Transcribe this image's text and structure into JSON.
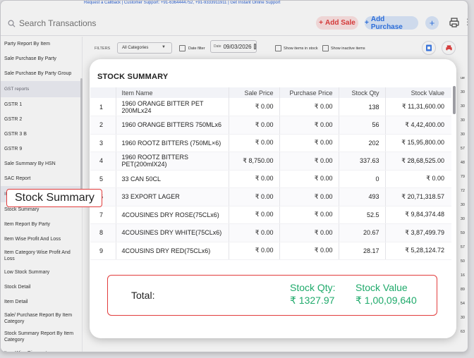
{
  "top_strip": "Request a Callback | Customer Support: +91-6364444752, +91-9333911911 | Get Instant Online Support",
  "header": {
    "search_placeholder": "Search Transactions",
    "add_sale": "Add Sale",
    "add_purchase": "Add Purchase",
    "plus": "+",
    "more": "⋮"
  },
  "sidebar": {
    "items": [
      {
        "label": "Party Report By Item",
        "type": "item"
      },
      {
        "label": "Sale Purchase By Party",
        "type": "item"
      },
      {
        "label": "Sale Purchase By Party Group",
        "type": "item"
      },
      {
        "label": "GST reports",
        "type": "section"
      },
      {
        "label": "GSTR 1",
        "type": "item"
      },
      {
        "label": "GSTR 2",
        "type": "item"
      },
      {
        "label": "GSTR 3 B",
        "type": "item"
      },
      {
        "label": "GSTR 9",
        "type": "item"
      },
      {
        "label": "Sale Summary By HSN",
        "type": "item"
      },
      {
        "label": "SAC Report",
        "type": "item"
      },
      {
        "label": "Item/ Stock report",
        "type": "section"
      },
      {
        "label": "Stock Summary",
        "type": "item"
      },
      {
        "label": "Item Report By Party",
        "type": "item"
      },
      {
        "label": "Item Wise Profit And Loss",
        "type": "item"
      },
      {
        "label": "Item Category Wise Profit And Loss",
        "type": "tall"
      },
      {
        "label": "Low Stock Summary",
        "type": "item"
      },
      {
        "label": "Stock Detail",
        "type": "item"
      },
      {
        "label": "Item Detail",
        "type": "item"
      },
      {
        "label": "Sale/ Purchase Report By Item Category",
        "type": "tall"
      },
      {
        "label": "Stock Summary Report By Item Category",
        "type": "tall"
      },
      {
        "label": "Item Wise Discount",
        "type": "item"
      }
    ],
    "highlight_label": "Stock Summary"
  },
  "filters": {
    "label": "FILTERS",
    "category": "All Categories",
    "date_filter_label": "Date filter",
    "date_caption": "Date",
    "date_value": "09/03/2026",
    "items_in_stock_label": "Show items in stock",
    "inactive_label": "Show inactive items"
  },
  "bg_right_col": [
    "ue",
    "30",
    "30",
    "30",
    "30",
    "57",
    "48",
    "79",
    "72",
    "30",
    "30",
    "59",
    "57",
    "50",
    "16",
    "89",
    "54",
    "30",
    "63"
  ],
  "modal": {
    "title": "STOCK SUMMARY",
    "columns": [
      "",
      "Item Name",
      "Sale Price",
      "Purchase Price",
      "Stock Qty",
      "Stock Value"
    ],
    "rows": [
      {
        "idx": "1",
        "name": "1960 ORANGE BITTER PET 200MLx24",
        "sale": "₹ 0.00",
        "purchase": "₹ 0.00",
        "qty": "138",
        "value": "₹ 11,31,600.00"
      },
      {
        "idx": "2",
        "name": "1960 ORANGE BITTERS 750MLx6",
        "sale": "₹ 0.00",
        "purchase": "₹ 0.00",
        "qty": "56",
        "value": "₹ 4,42,400.00"
      },
      {
        "idx": "3",
        "name": "1960 ROOTZ BITTERS (750ML×6)",
        "sale": "₹ 0.00",
        "purchase": "₹ 0.00",
        "qty": "202",
        "value": "₹ 15,95,800.00"
      },
      {
        "idx": "4",
        "name": "1960 ROOTZ BITTERS PET(200mlX24)",
        "sale": "₹ 8,750.00",
        "purchase": "₹ 0.00",
        "qty": "337.63",
        "value": "₹ 28,68,525.00"
      },
      {
        "idx": "5",
        "name": "33 CAN 50CL",
        "sale": "₹ 0.00",
        "purchase": "₹ 0.00",
        "qty": "0",
        "value": "₹ 0.00"
      },
      {
        "idx": "6",
        "name": "33 EXPORT LAGER",
        "sale": "₹ 0.00",
        "purchase": "₹ 0.00",
        "qty": "493",
        "value": "₹ 20,71,318.57"
      },
      {
        "idx": "7",
        "name": "4COUSINES DRY ROSE(75CLx6)",
        "sale": "₹ 0.00",
        "purchase": "₹ 0.00",
        "qty": "52.5",
        "value": "₹ 9,84,374.48"
      },
      {
        "idx": "8",
        "name": "4COUSINES DRY WHITE(75CLx6)",
        "sale": "₹ 0.00",
        "purchase": "₹ 0.00",
        "qty": "20.67",
        "value": "₹ 3,87,499.79"
      },
      {
        "idx": "9",
        "name": "4COUSINS DRY RED(75CLx6)",
        "sale": "₹ 0.00",
        "purchase": "₹ 0.00",
        "qty": "28.17",
        "value": "₹ 5,28,124.72"
      }
    ],
    "total": {
      "label": "Total:",
      "qty_label": "Stock Qty:",
      "qty_value": "₹ 1327.97",
      "value_label": "Stock Value",
      "value_value": "₹ 1,00,09,640"
    }
  },
  "colors": {
    "accent_red": "#e23c3c",
    "accent_blue": "#2f74e6",
    "qty_green": "#1faa6b"
  }
}
